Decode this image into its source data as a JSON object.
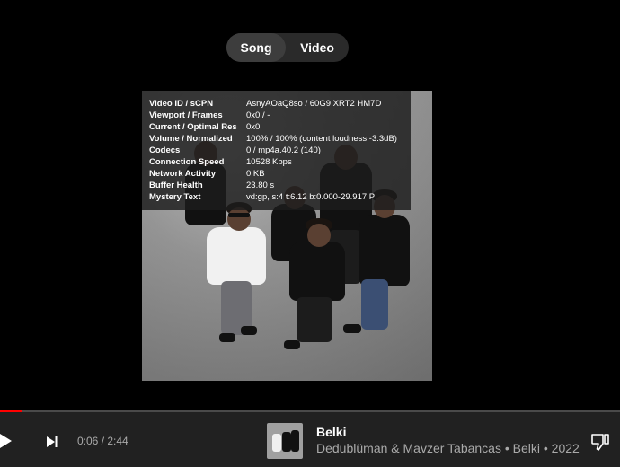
{
  "mode_toggle": {
    "song_label": "Song",
    "video_label": "Video",
    "selected": "Song"
  },
  "stats": [
    {
      "label": "Video ID / sCPN",
      "value": "AsnyAOaQ8so / 60G9 XRT2 HM7D"
    },
    {
      "label": "Viewport / Frames",
      "value": "0x0 / -"
    },
    {
      "label": "Current / Optimal Res",
      "value": "0x0"
    },
    {
      "label": "Volume / Normalized",
      "value": "100% / 100% (content loudness -3.3dB)"
    },
    {
      "label": "Codecs",
      "value": "0 / mp4a.40.2 (140)"
    },
    {
      "label": "Connection Speed",
      "value": "10528 Kbps"
    },
    {
      "label": "Network Activity",
      "value": "0 KB"
    },
    {
      "label": "Buffer Health",
      "value": "23.80 s"
    },
    {
      "label": "Mystery Text",
      "value": "vd:gp, s:4 t:6.12 b:0.000-29.917 P"
    }
  ],
  "player": {
    "time": "0:06 / 2:44",
    "progress_fraction": 0.0366,
    "title": "Belki",
    "meta": "Dedublüman & Mavzer Tabancas • Belki • 2022"
  },
  "colors": {
    "background": "#000000",
    "bar": "#212121",
    "progress": "#ff0000",
    "secondary_text": "#aaaaaa"
  },
  "icons": {
    "play": "play-icon",
    "next": "skip-next-icon",
    "dislike": "thumbs-down-icon"
  }
}
